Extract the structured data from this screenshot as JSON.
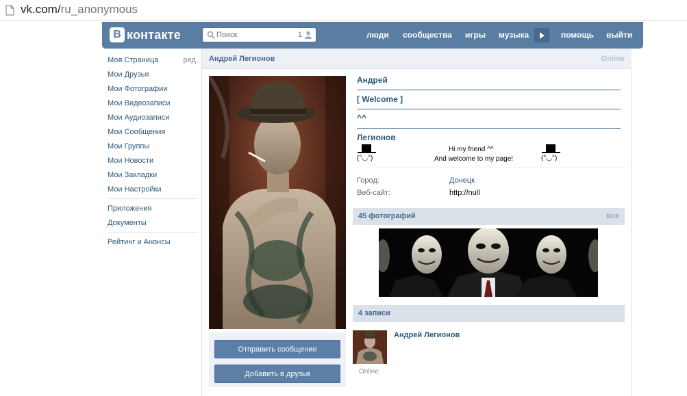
{
  "browser": {
    "url_domain": "vk.com/",
    "url_path": "ru_anonymous"
  },
  "header": {
    "logo_letter": "В",
    "logo_text": "контакте",
    "search_placeholder": "Поиск",
    "search_count": "1",
    "nav": {
      "people": "люди",
      "communities": "сообщества",
      "games": "игры",
      "music": "музыка",
      "help": "помощь",
      "logout": "выйти"
    },
    "colors": {
      "bar": "#597da3",
      "accent": "#45688e"
    }
  },
  "sidebar": {
    "edit_label": "ред.",
    "items": [
      {
        "label": "Моя Страница"
      },
      {
        "label": "Мои Друзья"
      },
      {
        "label": "Мои Фотографии"
      },
      {
        "label": "Мои Видеозаписи"
      },
      {
        "label": "Мои Аудиозаписи"
      },
      {
        "label": "Мои Сообщения"
      },
      {
        "label": "Мои Группы"
      },
      {
        "label": "Мои Новости"
      },
      {
        "label": "Мои Закладки"
      },
      {
        "label": "Мои Настройки"
      }
    ],
    "extra": [
      {
        "label": "Приложения"
      },
      {
        "label": "Документы"
      }
    ],
    "rating": "Рейтинг и Анонсы"
  },
  "profile": {
    "full_name": "Андрей Легионов",
    "online_status": "Online",
    "first_line": "Андрей",
    "welcome": "[ Welcome ]",
    "emote": "^^",
    "last_line": "Легионов",
    "ascii_left": "(°◡°)",
    "ascii_right": "(°◡°)",
    "greeting_1": "Hi my friend ^^",
    "greeting_2": "And welcome to my page!",
    "city_label": "Город:",
    "city_value": "Донецк",
    "website_label": "Веб-сайт:",
    "website_value": "http://null",
    "send_message": "Отправить сообщение",
    "add_friend": "Добавить в друзья",
    "photos_header": "45 фотографий",
    "photos_all": "все",
    "posts_header": "4 записи",
    "post_author": "Андрей Легионов",
    "post_status": "Online"
  }
}
